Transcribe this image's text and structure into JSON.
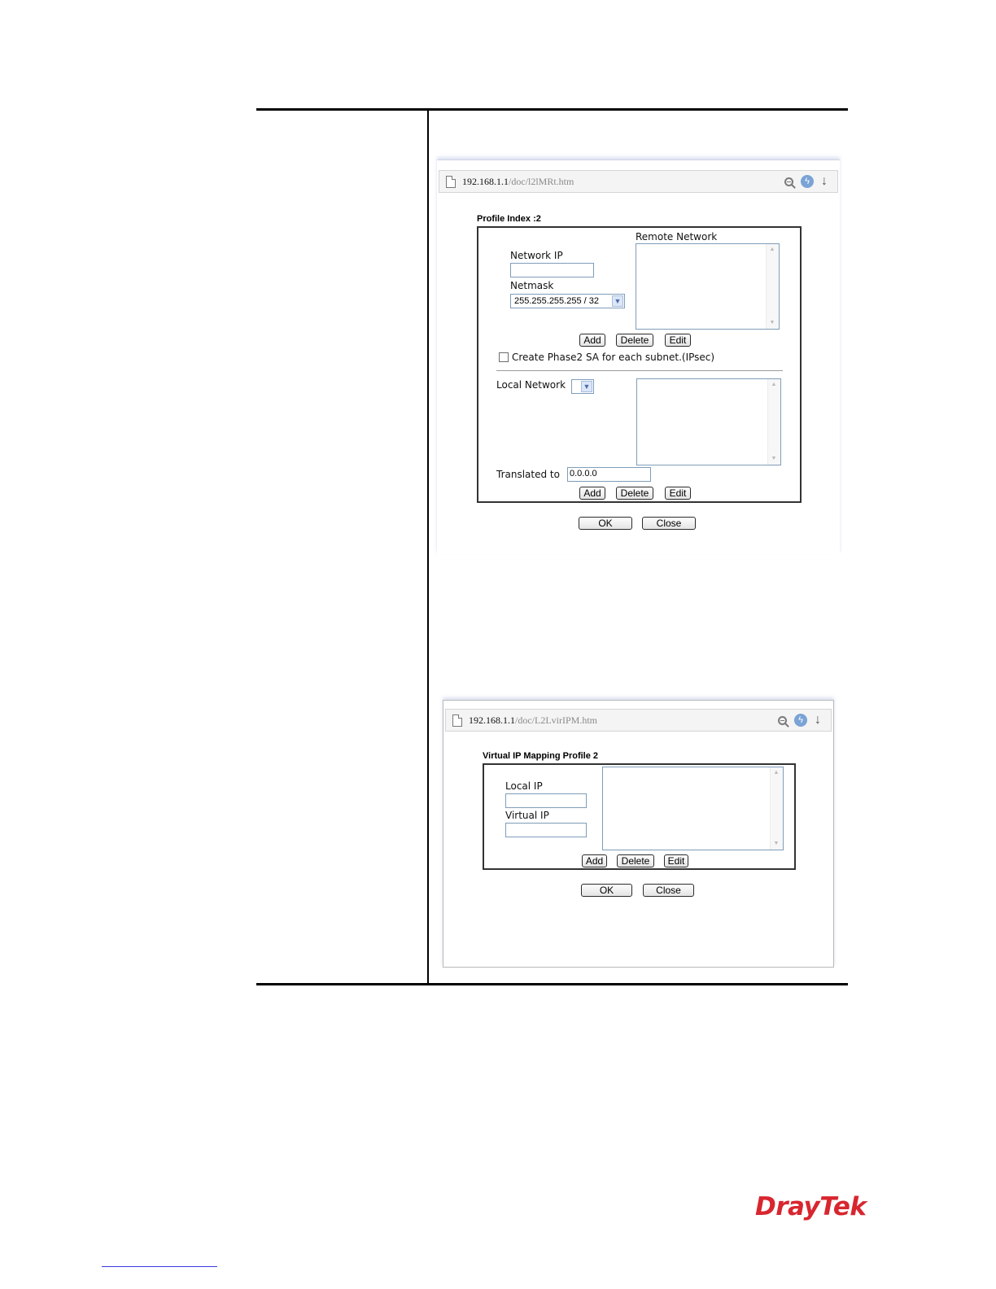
{
  "window1": {
    "url_host": "192.168.1.1",
    "url_path": "/doc/l2lMRt.htm",
    "title": "Profile Index :2",
    "remote_network_label": "Remote Network",
    "network_ip_label": "Network IP",
    "network_ip_value": "",
    "netmask_label": "Netmask",
    "netmask_value": "255.255.255.255 / 32",
    "add_label": "Add",
    "delete_label": "Delete",
    "edit_label": "Edit",
    "phase2_label": "Create Phase2 SA for each subnet.(IPsec)",
    "phase2_checked": false,
    "local_network_label": "Local Network",
    "local_network_value": "",
    "translated_to_label": "Translated to",
    "translated_to_value": "0.0.0.0",
    "ok_label": "OK",
    "close_label": "Close"
  },
  "window2": {
    "url_host": "192.168.1.1",
    "url_path": "/doc/L2LvirIPM.htm",
    "title": "Virtual IP Mapping Profile 2",
    "local_ip_label": "Local IP",
    "local_ip_value": "",
    "virtual_ip_label": "Virtual IP",
    "virtual_ip_value": "",
    "add_label": "Add",
    "delete_label": "Delete",
    "edit_label": "Edit",
    "ok_label": "OK",
    "close_label": "Close"
  },
  "logo_text": "DrayTek",
  "colors": {
    "logo": "#d8262f",
    "input_border": "#7f9db9"
  }
}
